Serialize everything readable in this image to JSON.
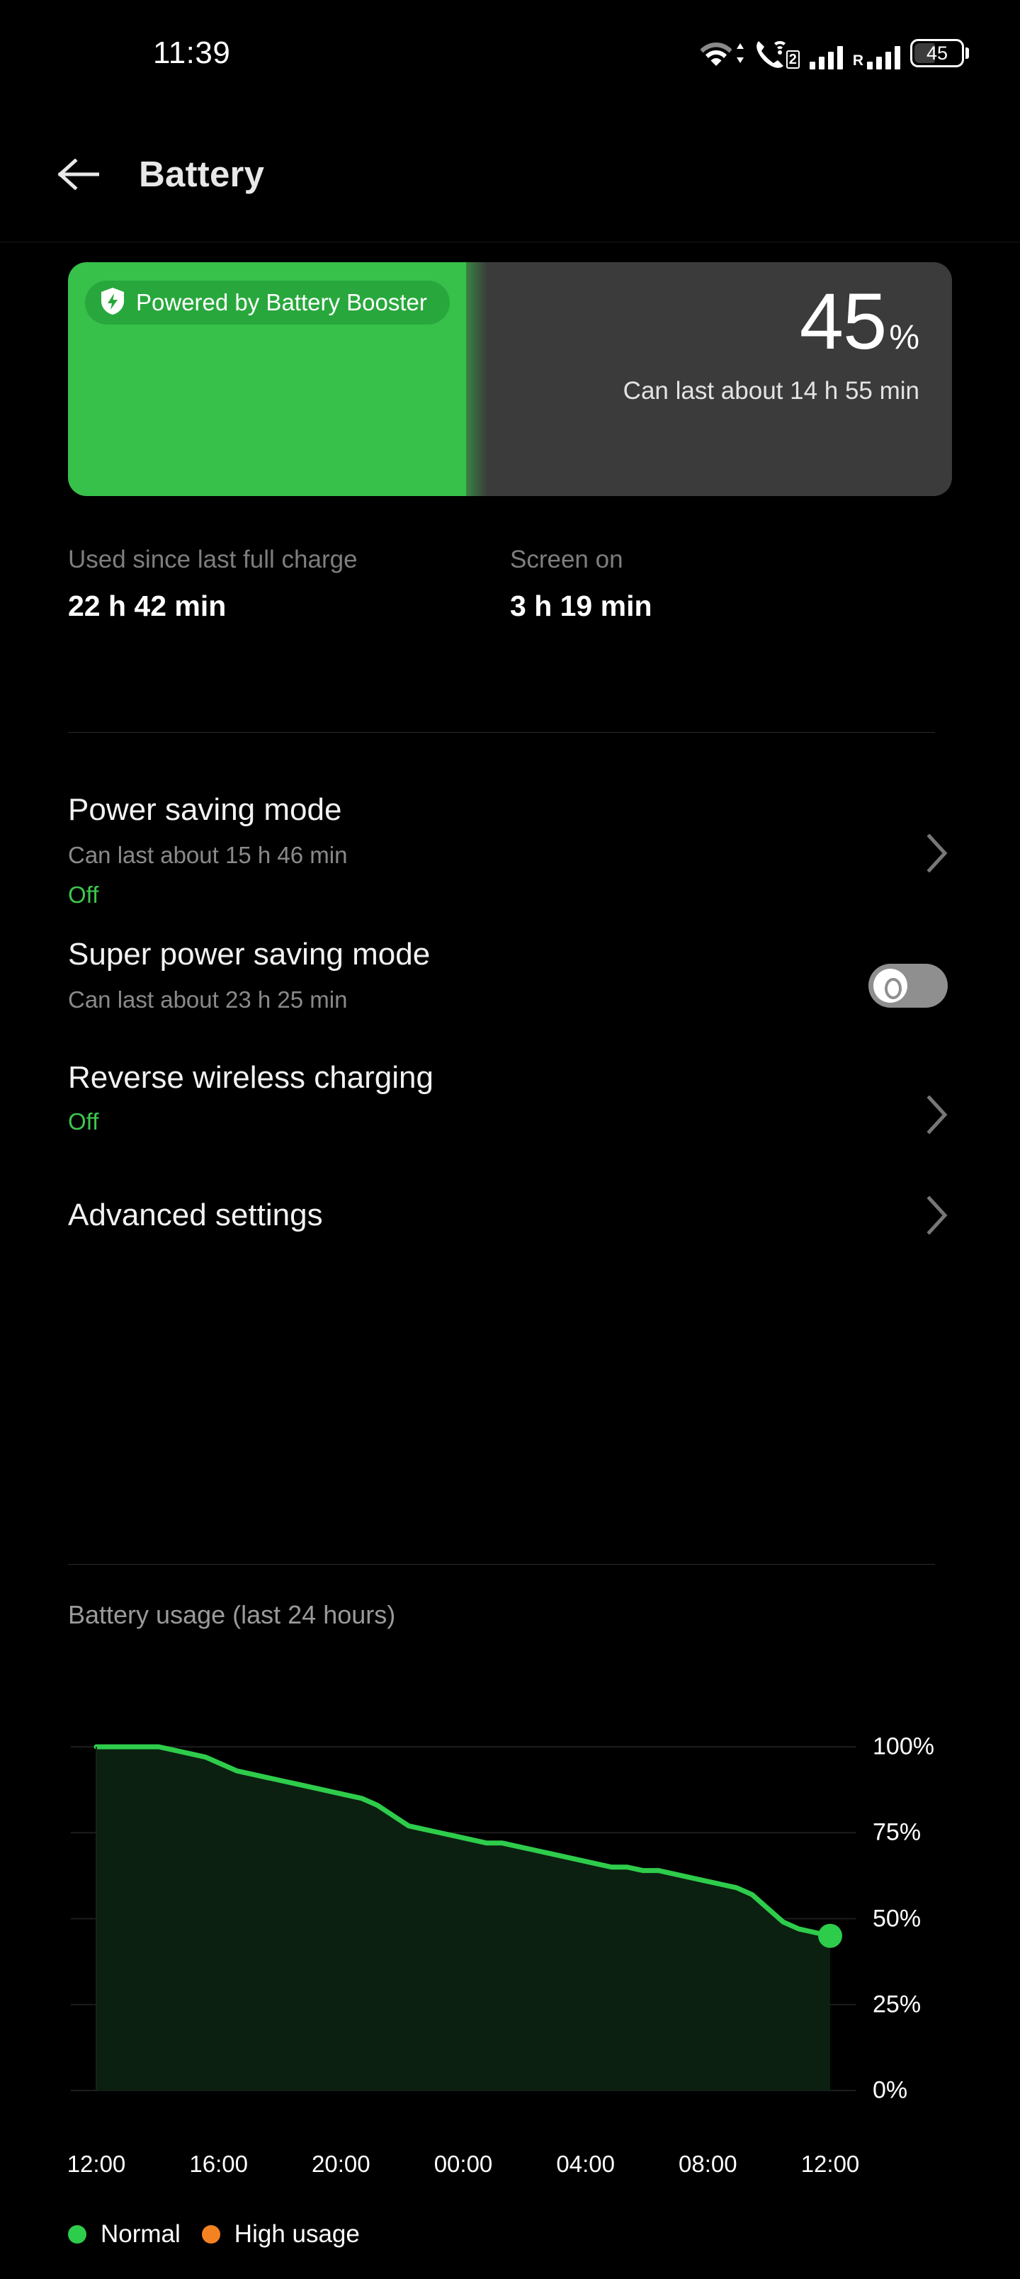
{
  "status_bar": {
    "time": "11:39",
    "battery_level": "45",
    "sim_badge": "2",
    "roaming_label": "R",
    "icons": [
      "wifi-icon",
      "vowifi-call-icon",
      "signal-bars-icon",
      "roaming-signal-icon",
      "battery-icon"
    ]
  },
  "appbar": {
    "back_icon": "back-arrow-icon",
    "title": "Battery"
  },
  "battery_card": {
    "badge_text": "Powered by Battery Booster",
    "badge_icon": "shield-bolt-icon",
    "percent_value": "45",
    "percent_sign": "%",
    "fill_ratio": 45,
    "subtitle": "Can last about 14 h 55 min",
    "fill_color": "#37c04a",
    "track_color": "#3b3b3b",
    "badge_color": "#28a83c"
  },
  "stats": [
    {
      "label": "Used since last full charge",
      "value": "22 h 42 min"
    },
    {
      "label": "Screen on",
      "value": "3 h 19 min"
    }
  ],
  "settings_rows": [
    {
      "title": "Power saving mode",
      "subtitle": "Can last about 15 h 46 min",
      "state": "Off",
      "control": "chevron"
    },
    {
      "title": "Super power saving mode",
      "subtitle": "Can last about 23 h 25 min",
      "state": "",
      "control": "toggle",
      "toggle_on": false
    },
    {
      "title": "Reverse wireless charging",
      "subtitle": "",
      "state": "Off",
      "control": "chevron"
    },
    {
      "title": "Advanced settings",
      "subtitle": "",
      "state": "",
      "control": "chevron"
    }
  ],
  "chart_section": {
    "title": "Battery usage (last 24 hours)"
  },
  "chart_data": {
    "type": "area",
    "title": "Battery usage (last 24 hours)",
    "xlabel": "",
    "ylabel": "",
    "ylim": [
      0,
      100
    ],
    "grid": true,
    "y_ticks": [
      "0%",
      "25%",
      "50%",
      "75%",
      "100%"
    ],
    "y_tick_values": [
      0,
      25,
      50,
      75,
      100
    ],
    "x_ticks": [
      "12:00",
      "16:00",
      "20:00",
      "00:00",
      "04:00",
      "08:00",
      "12:00"
    ],
    "legend": [
      {
        "label": "Normal",
        "color": "#2ecc4b"
      },
      {
        "label": "High usage",
        "color": "#f58220"
      }
    ],
    "legend_position": "bottom-left",
    "line_color": "#2ecc4b",
    "fill_color": "#0b2010",
    "end_marker_value": 45,
    "series": [
      {
        "name": "Battery level",
        "x": [
          "12:00",
          "12:30",
          "13:00",
          "13:30",
          "14:00",
          "14:30",
          "15:00",
          "15:30",
          "16:00",
          "16:30",
          "17:00",
          "17:30",
          "18:00",
          "18:30",
          "19:00",
          "19:30",
          "20:00",
          "20:30",
          "21:00",
          "21:30",
          "22:00",
          "22:30",
          "23:00",
          "23:30",
          "00:00",
          "00:30",
          "01:00",
          "01:30",
          "02:00",
          "02:30",
          "03:00",
          "03:30",
          "04:00",
          "04:30",
          "05:00",
          "05:30",
          "06:00",
          "06:30",
          "07:00",
          "07:30",
          "08:00",
          "08:30",
          "09:00",
          "09:30",
          "10:00",
          "10:30",
          "11:00",
          "11:39"
        ],
        "values": [
          100,
          100,
          100,
          100,
          100,
          99,
          98,
          97,
          95,
          93,
          92,
          91,
          90,
          89,
          88,
          87,
          86,
          85,
          83,
          80,
          77,
          76,
          75,
          74,
          73,
          72,
          72,
          71,
          70,
          69,
          68,
          67,
          66,
          65,
          65,
          64,
          64,
          63,
          62,
          61,
          60,
          59,
          57,
          53,
          49,
          47,
          46,
          45
        ]
      }
    ]
  }
}
